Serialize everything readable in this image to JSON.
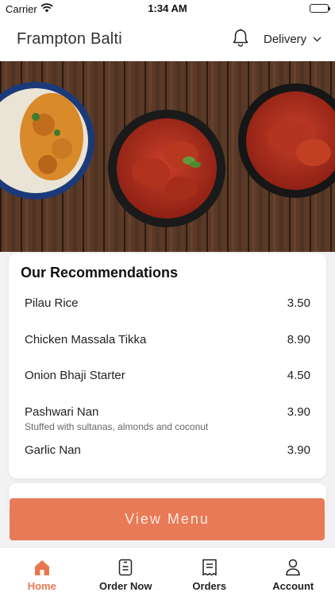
{
  "status_bar": {
    "carrier": "Carrier",
    "time": "1:34 AM"
  },
  "header": {
    "title": "Frampton Balti",
    "order_mode": "Delivery"
  },
  "recommendations": {
    "heading": "Our Recommendations",
    "items": [
      {
        "name": "Pilau Rice",
        "price": "3.50",
        "description": ""
      },
      {
        "name": "Chicken Massala Tikka",
        "price": "8.90",
        "description": ""
      },
      {
        "name": "Onion Bhaji Starter",
        "price": "4.50",
        "description": ""
      },
      {
        "name": "Pashwari Nan",
        "price": "3.90",
        "description": "Stuffed with sultanas, almonds and coconut"
      },
      {
        "name": "Garlic Nan",
        "price": "3.90",
        "description": ""
      }
    ]
  },
  "cta": {
    "label": "View Menu"
  },
  "tabbar": {
    "active": "Home",
    "tabs": [
      {
        "label": "Home",
        "icon": "home-icon"
      },
      {
        "label": "Order Now",
        "icon": "order-icon"
      },
      {
        "label": "Orders",
        "icon": "receipt-icon"
      },
      {
        "label": "Account",
        "icon": "person-icon"
      }
    ]
  },
  "colors": {
    "accent": "#e97a57",
    "active_tab": "#e8774f"
  }
}
